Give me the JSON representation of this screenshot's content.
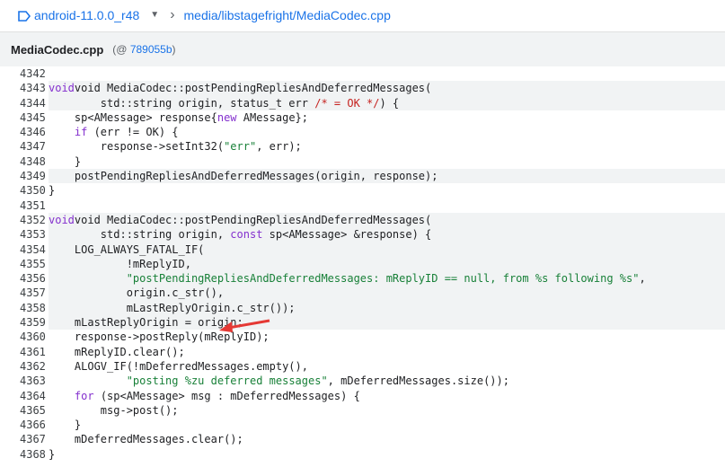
{
  "breadcrumb": {
    "branch": "android-11.0.0_r48",
    "separator": "›",
    "path": "media/libstagefright/MediaCodec.cpp"
  },
  "file": {
    "name": "MediaCodec.cpp",
    "commit_prefix": "(@ ",
    "commit_hash": "789055b",
    "commit_suffix": ")"
  },
  "code": {
    "l4342": {
      "num": "4342",
      "text": ""
    },
    "l4343": {
      "num": "4343",
      "a": "void MediaCodec::postPendingRepliesAndDeferredMessages("
    },
    "l4344": {
      "num": "4344",
      "a": "        std::string origin, status_t err ",
      "b": "/* = OK */",
      "c": ") {"
    },
    "l4345": {
      "num": "4345",
      "a": "    sp<AMessage> response{",
      "b": "new",
      "c": " AMessage};"
    },
    "l4346": {
      "num": "4346",
      "a": "    ",
      "b": "if",
      "c": " (err != OK) {"
    },
    "l4347": {
      "num": "4347",
      "a": "        response->setInt32(",
      "b": "\"err\"",
      "c": ", err);"
    },
    "l4348": {
      "num": "4348",
      "a": "    }"
    },
    "l4349": {
      "num": "4349",
      "a": "    postPendingRepliesAndDeferredMessages(origin, response);"
    },
    "l4350": {
      "num": "4350",
      "a": "}"
    },
    "l4351": {
      "num": "4351",
      "a": ""
    },
    "l4352": {
      "num": "4352",
      "a": "void MediaCodec::postPendingRepliesAndDeferredMessages("
    },
    "l4353": {
      "num": "4353",
      "a": "        std::string origin, ",
      "b": "const",
      "c": " sp<AMessage> &response) {"
    },
    "l4354": {
      "num": "4354",
      "a": "    LOG_ALWAYS_FATAL_IF("
    },
    "l4355": {
      "num": "4355",
      "a": "            !mReplyID,"
    },
    "l4356": {
      "num": "4356",
      "a": "            ",
      "b": "\"postPendingRepliesAndDeferredMessages: mReplyID == null, from %s following %s\"",
      "c": ","
    },
    "l4357": {
      "num": "4357",
      "a": "            origin.c_str(),"
    },
    "l4358": {
      "num": "4358",
      "a": "            mLastReplyOrigin.c_str());"
    },
    "l4359": {
      "num": "4359",
      "a": "    mLastReplyOrigin = origin;"
    },
    "l4360": {
      "num": "4360",
      "a": "    response->postReply(mReplyID);"
    },
    "l4361": {
      "num": "4361",
      "a": "    mReplyID.clear();"
    },
    "l4362": {
      "num": "4362",
      "a": "    ALOGV_IF(!mDeferredMessages.empty(),"
    },
    "l4363": {
      "num": "4363",
      "a": "            ",
      "b": "\"posting %zu deferred messages\"",
      "c": ", mDeferredMessages.size());"
    },
    "l4364": {
      "num": "4364",
      "a": "    ",
      "b": "for",
      "c": " (sp<AMessage> msg : mDeferredMessages) {"
    },
    "l4365": {
      "num": "4365",
      "a": "        msg->post();"
    },
    "l4366": {
      "num": "4366",
      "a": "    }"
    },
    "l4367": {
      "num": "4367",
      "a": "    mDeferredMessages.clear();"
    },
    "l4368": {
      "num": "4368",
      "a": "}"
    }
  },
  "colors": {
    "link": "#1a73e8",
    "keyword": "#8430ce",
    "string": "#188038",
    "comment": "#c5221f",
    "highlight": "#f1f3f4",
    "arrow": "#e53935"
  },
  "icons": {
    "repo": "repo-icon",
    "caret": "caret-down-icon",
    "annotation": "red-arrow-icon"
  }
}
